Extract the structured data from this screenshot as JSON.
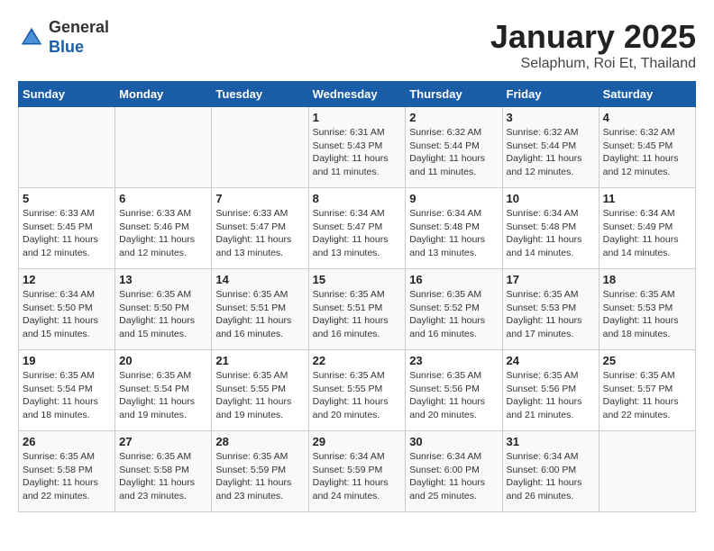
{
  "header": {
    "logo_line1": "General",
    "logo_line2": "Blue",
    "month": "January 2025",
    "location": "Selaphum, Roi Et, Thailand"
  },
  "weekdays": [
    "Sunday",
    "Monday",
    "Tuesday",
    "Wednesday",
    "Thursday",
    "Friday",
    "Saturday"
  ],
  "weeks": [
    [
      {
        "day": "",
        "info": ""
      },
      {
        "day": "",
        "info": ""
      },
      {
        "day": "",
        "info": ""
      },
      {
        "day": "1",
        "info": "Sunrise: 6:31 AM\nSunset: 5:43 PM\nDaylight: 11 hours\nand 11 minutes."
      },
      {
        "day": "2",
        "info": "Sunrise: 6:32 AM\nSunset: 5:44 PM\nDaylight: 11 hours\nand 11 minutes."
      },
      {
        "day": "3",
        "info": "Sunrise: 6:32 AM\nSunset: 5:44 PM\nDaylight: 11 hours\nand 12 minutes."
      },
      {
        "day": "4",
        "info": "Sunrise: 6:32 AM\nSunset: 5:45 PM\nDaylight: 11 hours\nand 12 minutes."
      }
    ],
    [
      {
        "day": "5",
        "info": "Sunrise: 6:33 AM\nSunset: 5:45 PM\nDaylight: 11 hours\nand 12 minutes."
      },
      {
        "day": "6",
        "info": "Sunrise: 6:33 AM\nSunset: 5:46 PM\nDaylight: 11 hours\nand 12 minutes."
      },
      {
        "day": "7",
        "info": "Sunrise: 6:33 AM\nSunset: 5:47 PM\nDaylight: 11 hours\nand 13 minutes."
      },
      {
        "day": "8",
        "info": "Sunrise: 6:34 AM\nSunset: 5:47 PM\nDaylight: 11 hours\nand 13 minutes."
      },
      {
        "day": "9",
        "info": "Sunrise: 6:34 AM\nSunset: 5:48 PM\nDaylight: 11 hours\nand 13 minutes."
      },
      {
        "day": "10",
        "info": "Sunrise: 6:34 AM\nSunset: 5:48 PM\nDaylight: 11 hours\nand 14 minutes."
      },
      {
        "day": "11",
        "info": "Sunrise: 6:34 AM\nSunset: 5:49 PM\nDaylight: 11 hours\nand 14 minutes."
      }
    ],
    [
      {
        "day": "12",
        "info": "Sunrise: 6:34 AM\nSunset: 5:50 PM\nDaylight: 11 hours\nand 15 minutes."
      },
      {
        "day": "13",
        "info": "Sunrise: 6:35 AM\nSunset: 5:50 PM\nDaylight: 11 hours\nand 15 minutes."
      },
      {
        "day": "14",
        "info": "Sunrise: 6:35 AM\nSunset: 5:51 PM\nDaylight: 11 hours\nand 16 minutes."
      },
      {
        "day": "15",
        "info": "Sunrise: 6:35 AM\nSunset: 5:51 PM\nDaylight: 11 hours\nand 16 minutes."
      },
      {
        "day": "16",
        "info": "Sunrise: 6:35 AM\nSunset: 5:52 PM\nDaylight: 11 hours\nand 16 minutes."
      },
      {
        "day": "17",
        "info": "Sunrise: 6:35 AM\nSunset: 5:53 PM\nDaylight: 11 hours\nand 17 minutes."
      },
      {
        "day": "18",
        "info": "Sunrise: 6:35 AM\nSunset: 5:53 PM\nDaylight: 11 hours\nand 18 minutes."
      }
    ],
    [
      {
        "day": "19",
        "info": "Sunrise: 6:35 AM\nSunset: 5:54 PM\nDaylight: 11 hours\nand 18 minutes."
      },
      {
        "day": "20",
        "info": "Sunrise: 6:35 AM\nSunset: 5:54 PM\nDaylight: 11 hours\nand 19 minutes."
      },
      {
        "day": "21",
        "info": "Sunrise: 6:35 AM\nSunset: 5:55 PM\nDaylight: 11 hours\nand 19 minutes."
      },
      {
        "day": "22",
        "info": "Sunrise: 6:35 AM\nSunset: 5:55 PM\nDaylight: 11 hours\nand 20 minutes."
      },
      {
        "day": "23",
        "info": "Sunrise: 6:35 AM\nSunset: 5:56 PM\nDaylight: 11 hours\nand 20 minutes."
      },
      {
        "day": "24",
        "info": "Sunrise: 6:35 AM\nSunset: 5:56 PM\nDaylight: 11 hours\nand 21 minutes."
      },
      {
        "day": "25",
        "info": "Sunrise: 6:35 AM\nSunset: 5:57 PM\nDaylight: 11 hours\nand 22 minutes."
      }
    ],
    [
      {
        "day": "26",
        "info": "Sunrise: 6:35 AM\nSunset: 5:58 PM\nDaylight: 11 hours\nand 22 minutes."
      },
      {
        "day": "27",
        "info": "Sunrise: 6:35 AM\nSunset: 5:58 PM\nDaylight: 11 hours\nand 23 minutes."
      },
      {
        "day": "28",
        "info": "Sunrise: 6:35 AM\nSunset: 5:59 PM\nDaylight: 11 hours\nand 23 minutes."
      },
      {
        "day": "29",
        "info": "Sunrise: 6:34 AM\nSunset: 5:59 PM\nDaylight: 11 hours\nand 24 minutes."
      },
      {
        "day": "30",
        "info": "Sunrise: 6:34 AM\nSunset: 6:00 PM\nDaylight: 11 hours\nand 25 minutes."
      },
      {
        "day": "31",
        "info": "Sunrise: 6:34 AM\nSunset: 6:00 PM\nDaylight: 11 hours\nand 26 minutes."
      },
      {
        "day": "",
        "info": ""
      }
    ]
  ]
}
